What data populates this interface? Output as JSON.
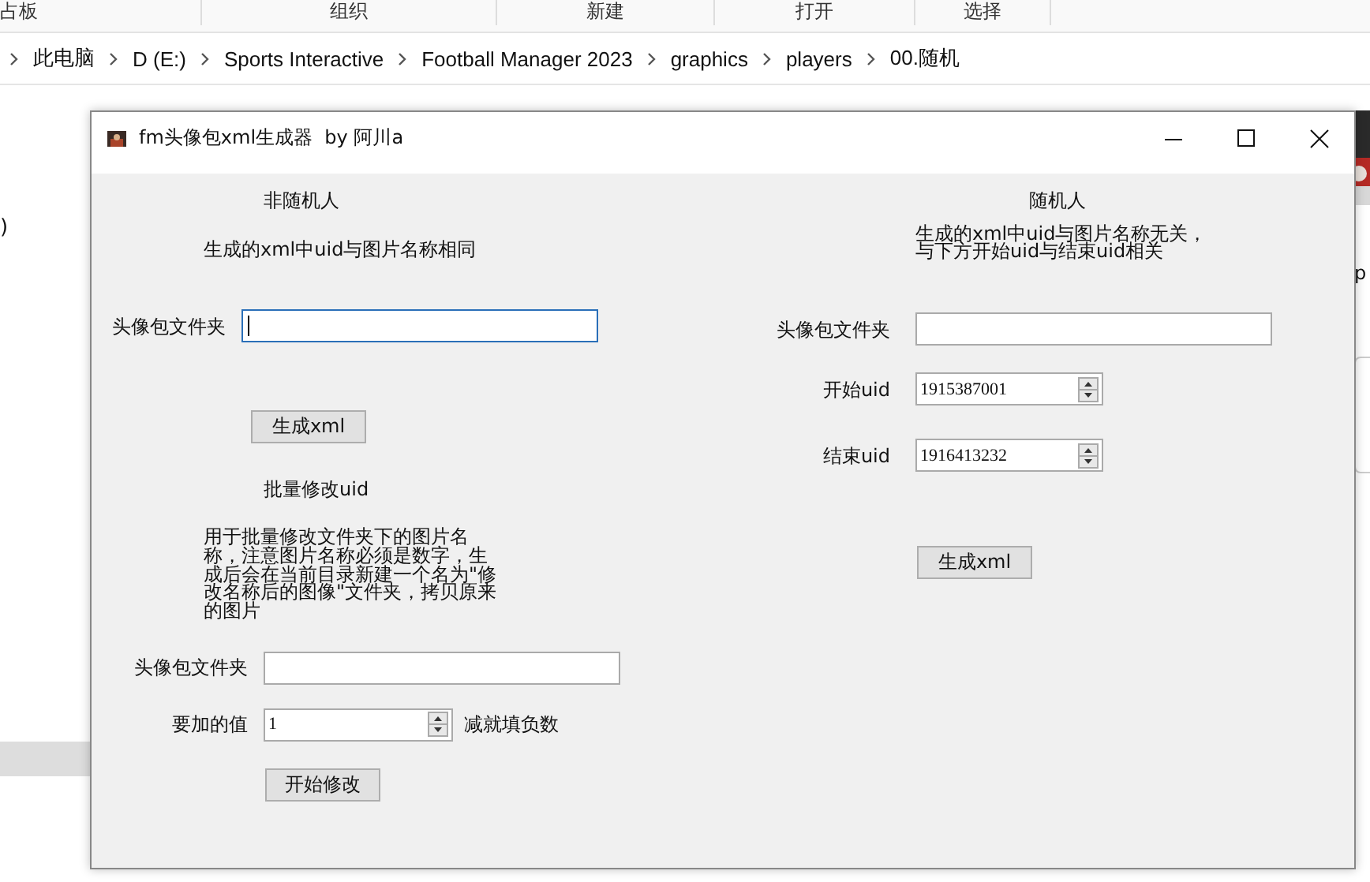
{
  "explorer": {
    "ribbon_groups": [
      "占板",
      "组织",
      "新建",
      "打开",
      "选择"
    ],
    "breadcrumb": [
      "此电脑",
      "D (E:)",
      "Sports Interactive",
      "Football Manager 2023",
      "graphics",
      "players",
      "00.随机"
    ],
    "edge_fragments": [
      ")",
      "p"
    ]
  },
  "dialog": {
    "title": "fm头像包xml生成器  by 阿川a",
    "left_panel": {
      "heading": "非随机人",
      "note": "生成的xml中uid与图片名称相同",
      "folder": {
        "label": "头像包文件夹",
        "focused": true
      },
      "generate_button": "生成xml",
      "batch": {
        "heading": "批量修改uid",
        "description": "用于批量修改文件夹下的图片名称，注意图片名称必须是数字，生成后会在当前目录新建一个名为\"修改名称后的图像\"文件夹，拷贝原来的图片",
        "folder": {
          "label": "头像包文件夹",
          "focused": false
        },
        "add_value": {
          "label": "要加的值",
          "value": "1",
          "hint": "减就填负数"
        },
        "start_button": "开始修改"
      }
    },
    "right_panel": {
      "heading": "随机人",
      "note_lines": [
        "生成的xml中uid与图片名称无关，",
        "与下方开始uid与结束uid相关"
      ],
      "folder": {
        "label": "头像包文件夹",
        "focused": false
      },
      "start_uid": {
        "label": "开始uid",
        "value": "1915387001"
      },
      "end_uid": {
        "label": "结束uid",
        "value": "1916413232"
      },
      "generate_button": "生成xml"
    }
  }
}
